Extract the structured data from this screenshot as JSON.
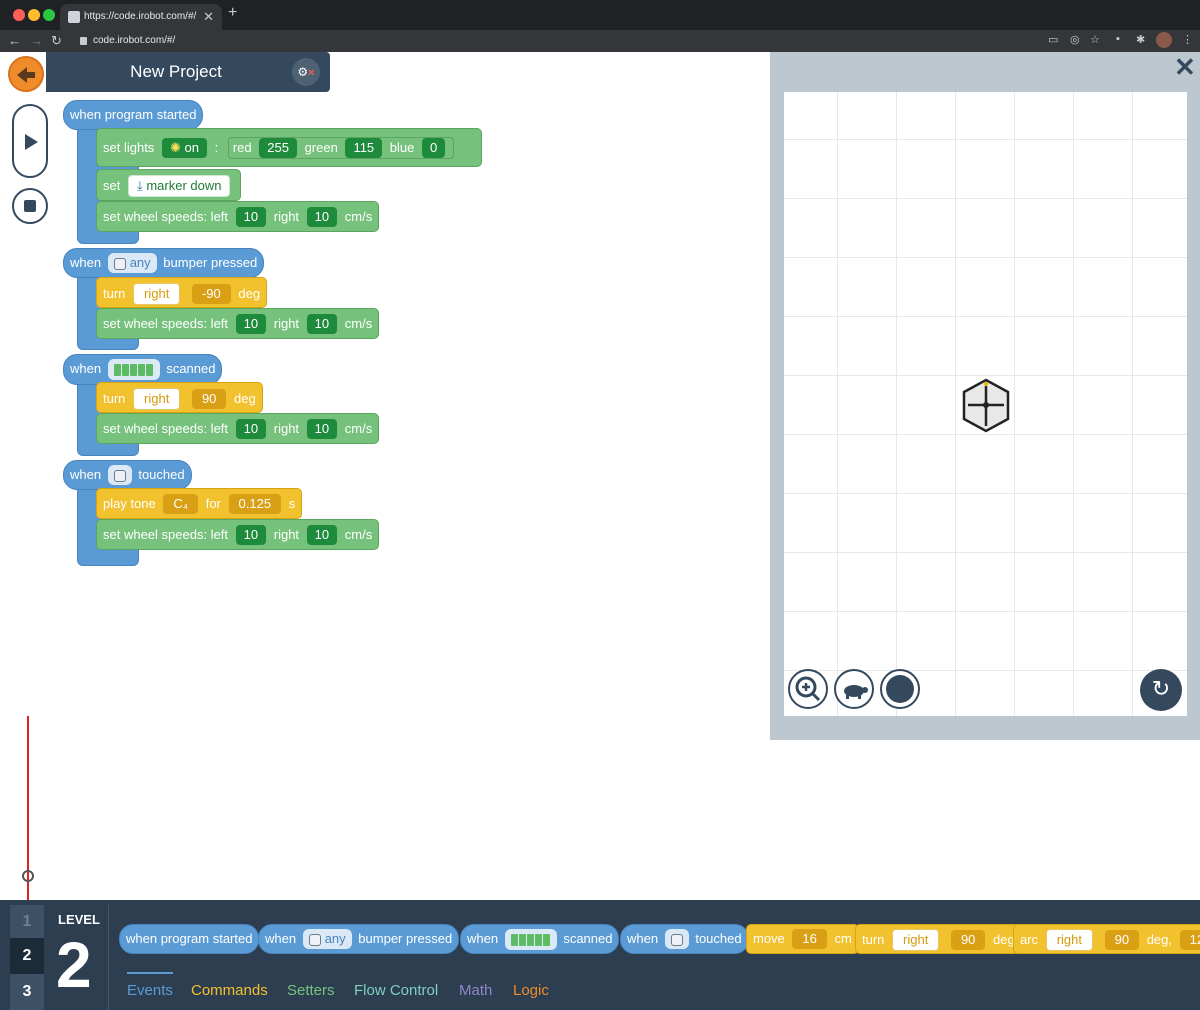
{
  "browser": {
    "tab_title": "https://code.irobot.com/#/",
    "url": "code.irobot.com/#/",
    "tab_close": "✕",
    "new_tab": "+"
  },
  "header": {
    "title": "New Project"
  },
  "program": {
    "start_event": "when program started",
    "set_lights_label": "set lights",
    "lights_state": "on",
    "colon": ":",
    "red_label": "red",
    "red_value": "255",
    "green_label": "green",
    "green_value": "115",
    "blue_label": "blue",
    "blue_value": "0",
    "set_label": "set",
    "marker_value": "marker down",
    "wheel_label": "set wheel speeds: left",
    "left_value": "10",
    "right_label": "right",
    "right_value": "10",
    "unit_cms": "cm/s",
    "when_label": "when",
    "bumper_value": "any",
    "bumper_suffix": "bumper pressed",
    "turn_label": "turn",
    "turn_dir": "right",
    "turn_1_value": "-90",
    "deg_label": "deg",
    "scanned_label": "scanned",
    "turn_2_value": "90",
    "touched_label": "touched",
    "play_tone_label": "play tone",
    "tone_note": "C₄",
    "for_label": "for",
    "tone_duration": "0.125",
    "s_label": "s"
  },
  "palette": {
    "level_label": "LEVEL",
    "level_value": "2",
    "levels": [
      "1",
      "2",
      "3"
    ],
    "blocks": {
      "program_started": "when program started",
      "when": "when",
      "any": "any",
      "bumper_pressed": "bumper pressed",
      "scanned": "scanned",
      "touched": "touched",
      "move": "move",
      "move_value": "16",
      "cm": "cm",
      "turn": "turn",
      "right": "right",
      "turn_value": "90",
      "deg": "deg",
      "arc": "arc",
      "arc_dir": "right",
      "arc_value": "90",
      "arc_deg": "deg,",
      "arc_radius": "12"
    },
    "categories": [
      {
        "label": "Events",
        "color": "#5a9bd5"
      },
      {
        "label": "Commands",
        "color": "#f2c12e"
      },
      {
        "label": "Setters",
        "color": "#76c27c"
      },
      {
        "label": "Flow Control",
        "color": "#7fd0c0"
      },
      {
        "label": "Math",
        "color": "#8e86c8"
      },
      {
        "label": "Logic",
        "color": "#f08b2c"
      }
    ]
  },
  "simulator": {
    "close": "✕",
    "reset_icon": "↻"
  }
}
